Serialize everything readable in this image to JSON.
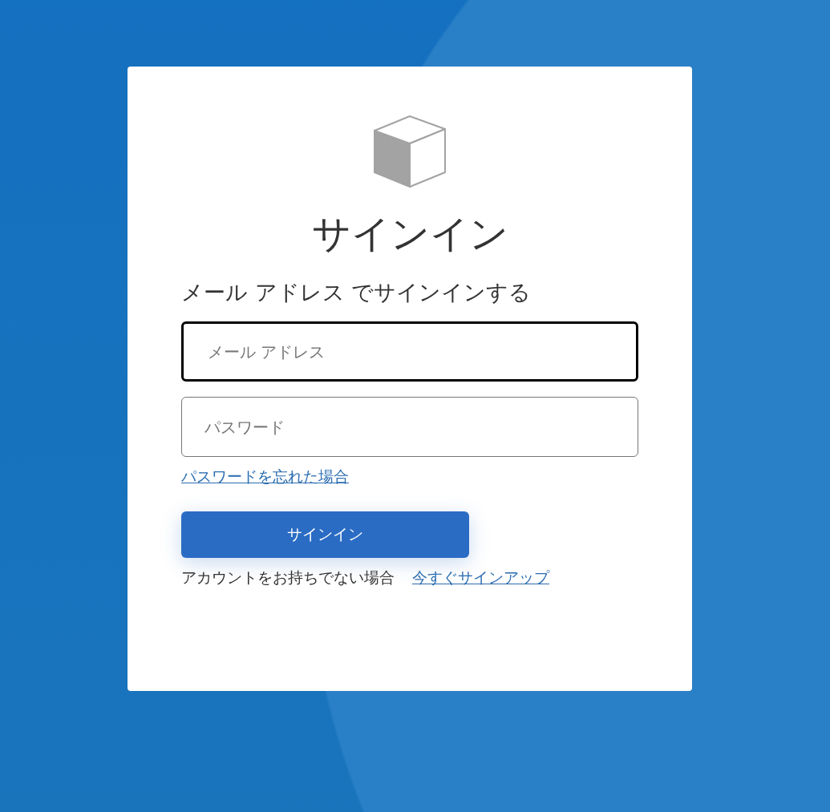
{
  "title": "サインイン",
  "subtitle": "メール アドレス でサインインする",
  "fields": [
    {
      "placeholder": "メール アドレス",
      "focused": true
    },
    {
      "placeholder": "パスワード",
      "focused": false
    }
  ],
  "forgot_link": "パスワードを忘れた場合",
  "submit_button": "サインイン",
  "signup": {
    "text": "アカウントをお持ちでない場合",
    "link": "今すぐサインアップ"
  }
}
